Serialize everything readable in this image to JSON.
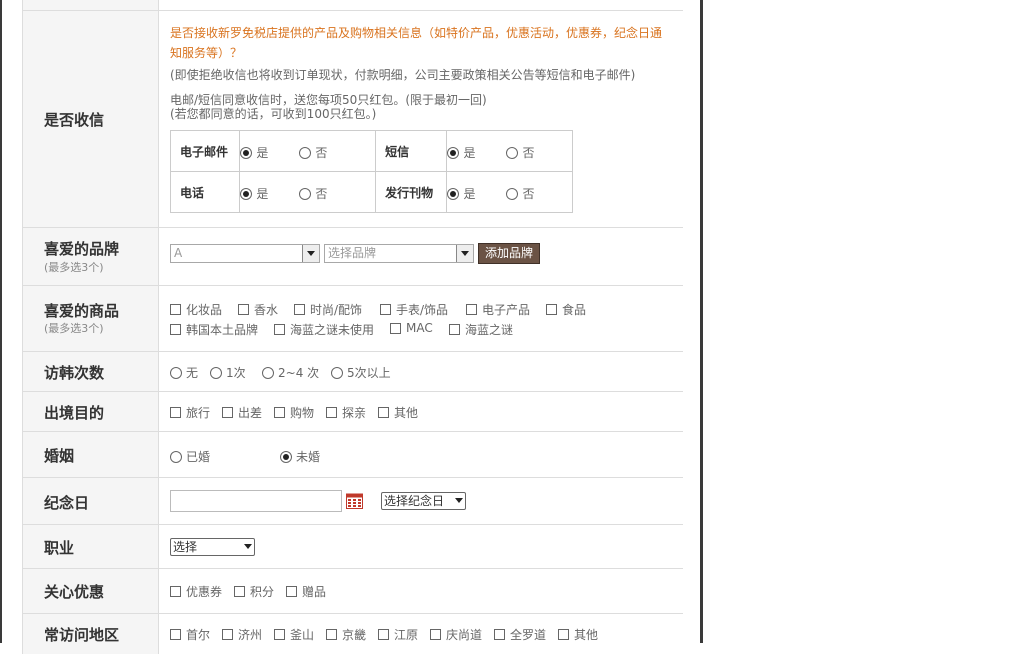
{
  "subscription": {
    "label": "是否收信",
    "notice_line1": "是否接收新罗免税店提供的产品及购物相关信息（如特价产品，优惠活动，优惠券，纪念日通",
    "notice_line2": "知服务等）？",
    "note": "(即使拒绝收信也将收到订单现状，付款明细，公司主要政策相关公告等短信和电子邮件)",
    "reward_line1": "电邮/短信同意收信时，送您每项50只红包。(限于最初一回)",
    "reward_line2": "(若您都同意的话，可收到100只红包。)",
    "yes": "是",
    "no": "否",
    "channels": [
      {
        "name": "电子邮件",
        "selected": "是"
      },
      {
        "name": "短信",
        "selected": "是"
      },
      {
        "name": "电话",
        "selected": "是"
      },
      {
        "name": "发行刊物",
        "selected": "是"
      }
    ]
  },
  "brand": {
    "label": "喜爱的品牌",
    "sub": "(最多选3个)",
    "letter_select": "A",
    "brand_select": "选择品牌",
    "add_button": "添加品牌"
  },
  "products": {
    "label": "喜爱的商品",
    "sub": "(最多选3个)",
    "options_row1": [
      "化妆品",
      "香水",
      "时尚/配饰",
      "手表/饰品",
      "电子产品",
      "食品"
    ],
    "options_row2": [
      "韩国本土品牌",
      "海蓝之谜未使用",
      "MAC",
      "海蓝之谜"
    ]
  },
  "visits": {
    "label": "访韩次数",
    "options": [
      "无",
      "1次",
      "2~4 次",
      "5次以上"
    ]
  },
  "purpose": {
    "label": "出境目的",
    "options": [
      "旅行",
      "出差",
      "购物",
      "探亲",
      "其他"
    ]
  },
  "marriage": {
    "label": "婚姻",
    "options": [
      "已婚",
      "未婚"
    ],
    "selected": "未婚"
  },
  "anniversary": {
    "label": "纪念日",
    "date_value": "",
    "select": "选择纪念日"
  },
  "job": {
    "label": "职业",
    "select": "选择"
  },
  "interest": {
    "label": "关心优惠",
    "options": [
      "优惠券",
      "积分",
      "赠品"
    ]
  },
  "regions": {
    "label": "常访问地区",
    "options": [
      "首尔",
      "济州",
      "釜山",
      "京畿",
      "江原",
      "庆尚道",
      "全罗道",
      "其他"
    ]
  },
  "colors": {
    "notice": "#d9731e",
    "button_bg": "#6b5345",
    "label_bg": "#f5f5f5",
    "calendar_icon": "#c0392b"
  },
  "icons": {
    "calendar": "calendar-icon"
  }
}
